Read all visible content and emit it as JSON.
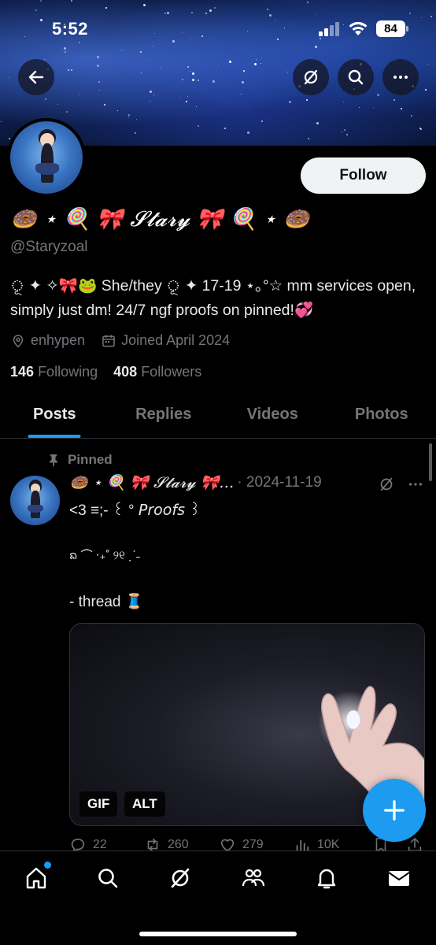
{
  "status_bar": {
    "time": "5:52",
    "battery": "84"
  },
  "profile": {
    "follow_label": "Follow",
    "display_name": "🍩 ⋆ 🍭 🎀 𝓢𝓽𝓪𝓻𝔂 🎀 🍭 ⋆ 🍩",
    "handle": "@Staryzoal",
    "bio": "ূ ✦ ✧🎀🐸 She/they ূ ✦ 17-19 ⋆｡°☆ mm services open, simply just dm! 24/7 ngf proofs on pinned!💞",
    "location": "enhypen",
    "joined": "Joined April 2024",
    "following_count": "146",
    "following_label": "Following",
    "followers_count": "408",
    "followers_label": "Followers"
  },
  "tabs": [
    {
      "label": "Posts",
      "active": true
    },
    {
      "label": "Replies",
      "active": false
    },
    {
      "label": "Videos",
      "active": false
    },
    {
      "label": "Photos",
      "active": false
    }
  ],
  "post": {
    "pinned_label": "Pinned",
    "author_name": "🍩 ⋆ 🍭 🎀 𝓢𝓽𝓪𝓻𝔂 🎀…",
    "date": "· 2024-11-19",
    "line1": "<3 ≡;- ꒰ ° 𝘗𝘳𝘰𝘰𝘧𝘴 ꒱",
    "line2": "ᨦ ⌒ ‧₊˚ ୨୧ ˎˊ˗",
    "line3": "- thread 🧵",
    "media_badges": [
      "GIF",
      "ALT"
    ],
    "actions": {
      "replies": "22",
      "reposts": "260",
      "likes": "279",
      "views": "10K"
    }
  },
  "colors": {
    "accent": "#1d9bf0",
    "background": "#000000",
    "secondary_text": "#71767b",
    "primary_text": "#e7e9ea"
  },
  "icons": {
    "header": [
      "back-arrow-icon",
      "grok-icon",
      "search-icon",
      "more-icon"
    ],
    "nav": [
      "home-icon",
      "search-icon",
      "grok-icon",
      "communities-icon",
      "notifications-icon",
      "messages-icon"
    ]
  }
}
